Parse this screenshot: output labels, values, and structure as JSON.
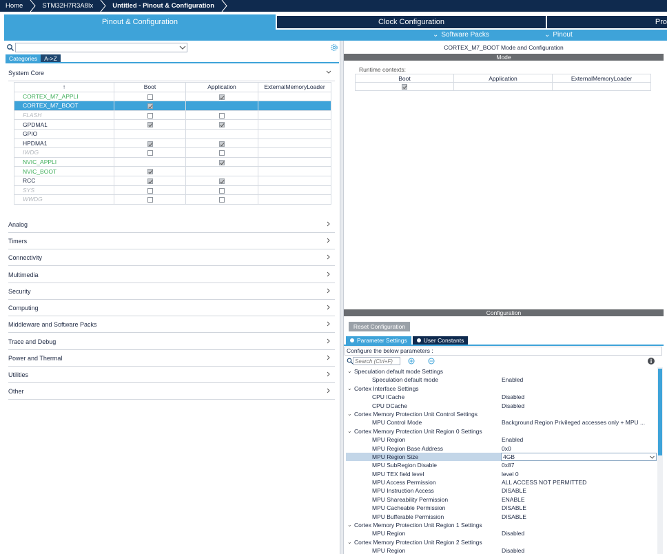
{
  "breadcrumb": [
    {
      "label": "Home"
    },
    {
      "label": "STM32H7R3A8Ix"
    },
    {
      "label": "Untitled - Pinout & Configuration"
    }
  ],
  "main_tabs": [
    {
      "label": "Pinout & Configuration",
      "active": true
    },
    {
      "label": "Clock Configuration",
      "active": false
    },
    {
      "label": "Pro",
      "active": false
    }
  ],
  "sub_tabs": [
    {
      "label": "Software Packs"
    },
    {
      "label": "Pinout"
    }
  ],
  "left": {
    "search_value": "",
    "view_tabs": [
      "Categories",
      "A->Z"
    ],
    "categories": [
      "System Core",
      "Analog",
      "Timers",
      "Connectivity",
      "Multimedia",
      "Security",
      "Computing",
      "Middleware and Software Packs",
      "Trace and Debug",
      "Power and Thermal",
      "Utilities",
      "Other"
    ],
    "table": {
      "sort_indicator": "↑",
      "headers": [
        "",
        "Boot",
        "Application",
        "ExternalMemoryLoader"
      ],
      "rows": [
        {
          "name": "CORTEX_M7_APPLI",
          "style": "green",
          "boot": false,
          "app": true,
          "selected": false
        },
        {
          "name": "CORTEX_M7_BOOT",
          "style": "green",
          "boot": true,
          "app": null,
          "selected": true
        },
        {
          "name": "FLASH",
          "style": "gray",
          "boot": false,
          "app": false,
          "selected": false
        },
        {
          "name": "GPDMA1",
          "style": "normal",
          "boot": true,
          "app": true,
          "selected": false
        },
        {
          "name": "GPIO",
          "style": "normal",
          "boot": null,
          "app": null,
          "selected": false
        },
        {
          "name": "HPDMA1",
          "style": "normal",
          "boot": true,
          "app": true,
          "selected": false
        },
        {
          "name": "IWDG",
          "style": "gray",
          "boot": false,
          "app": false,
          "selected": false
        },
        {
          "name": "NVIC_APPLI",
          "style": "green",
          "boot": null,
          "app": true,
          "selected": false
        },
        {
          "name": "NVIC_BOOT",
          "style": "green",
          "boot": true,
          "app": null,
          "selected": false
        },
        {
          "name": "RCC",
          "style": "normal",
          "boot": true,
          "app": true,
          "selected": false
        },
        {
          "name": "SYS",
          "style": "gray",
          "boot": false,
          "app": false,
          "selected": false
        },
        {
          "name": "WWDG",
          "style": "gray",
          "boot": false,
          "app": false,
          "selected": false
        }
      ]
    }
  },
  "right": {
    "title": "CORTEX_M7_BOOT Mode and Configuration",
    "mode_bar": "Mode",
    "runtime_label": "Runtime contexts:",
    "runtime_headers": [
      "Boot",
      "Application",
      "ExternalMemoryLoader"
    ],
    "runtime_boot_checked": true,
    "config_bar": "Configuration",
    "reset_label": "Reset Configuration",
    "cfg_tabs": [
      "Parameter Settings",
      "User Constants"
    ],
    "hint": "Configure the below parameters :",
    "param_search_placeholder": "Search (Ctrl+F)",
    "params": [
      {
        "type": "group",
        "label": "Speculation default mode Settings"
      },
      {
        "type": "item",
        "label": "Speculation default mode",
        "value": "Enabled"
      },
      {
        "type": "group",
        "label": "Cortex Interface Settings"
      },
      {
        "type": "item",
        "label": "CPU ICache",
        "value": "Disabled"
      },
      {
        "type": "item",
        "label": "CPU DCache",
        "value": "Disabled"
      },
      {
        "type": "group",
        "label": "Cortex Memory Protection Unit Control Settings"
      },
      {
        "type": "item",
        "label": "MPU Control Mode",
        "value": "Background Region Privileged accesses only + MPU Disable during hard fault, NMI and FAULTMASK handlers"
      },
      {
        "type": "group",
        "label": "Cortex Memory Protection Unit Region 0 Settings"
      },
      {
        "type": "item",
        "label": "MPU Region",
        "value": "Enabled"
      },
      {
        "type": "item",
        "label": "MPU Region Base Address",
        "value": "0x0"
      },
      {
        "type": "item",
        "label": "MPU Region Size",
        "value": "4GB",
        "selected": true
      },
      {
        "type": "item",
        "label": "MPU SubRegion Disable",
        "value": "0x87"
      },
      {
        "type": "item",
        "label": "MPU TEX field level",
        "value": "level 0"
      },
      {
        "type": "item",
        "label": "MPU Access Permission",
        "value": "ALL ACCESS NOT PERMITTED"
      },
      {
        "type": "item",
        "label": "MPU Instruction Access",
        "value": "DISABLE"
      },
      {
        "type": "item",
        "label": "MPU Shareability Permission",
        "value": "ENABLE"
      },
      {
        "type": "item",
        "label": "MPU Cacheable Permission",
        "value": "DISABLE"
      },
      {
        "type": "item",
        "label": "MPU Bufferable  Permission",
        "value": "DISABLE"
      },
      {
        "type": "group",
        "label": "Cortex Memory Protection Unit Region 1 Settings"
      },
      {
        "type": "item",
        "label": "MPU Region",
        "value": "Disabled"
      },
      {
        "type": "group",
        "label": "Cortex Memory Protection Unit Region 2 Settings"
      },
      {
        "type": "item",
        "label": "MPU Region",
        "value": "Disabled"
      }
    ]
  },
  "colors": {
    "navy": "#0f2a4e",
    "accent_blue": "#3ea3d9",
    "green_text": "#3fae5a",
    "selection_row": "#c3d6e8"
  }
}
